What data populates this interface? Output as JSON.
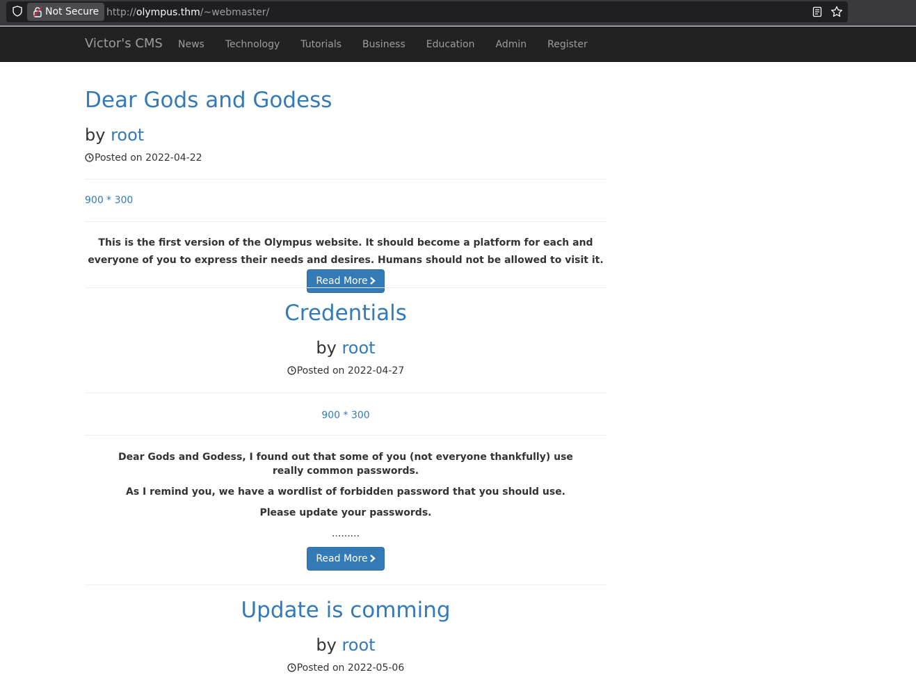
{
  "browser": {
    "security_label": "Not Secure",
    "url_scheme": "http://",
    "url_host": "olympus.thm",
    "url_path": "/~webmaster/"
  },
  "navbar": {
    "brand": "Victor's CMS",
    "links": [
      "News",
      "Technology",
      "Tutorials",
      "Business",
      "Education",
      "Admin",
      "Register"
    ]
  },
  "posts": [
    {
      "title": "Dear Gods and Godess",
      "by": "by",
      "author": "root",
      "posted_prefix": "Posted on",
      "date": "2022-04-22",
      "image_placeholder": "900 * 300",
      "excerpt": "This is the first version of the Olympus website. It should become a platform for each and everyone of you to express their needs and desires. Humans should not be allowed to visit it.",
      "read_more": "Read More"
    },
    {
      "title": "Credentials",
      "by": "by",
      "author": "root",
      "posted_prefix": "Posted on",
      "date": "2022-04-27",
      "image_placeholder": "900 * 300",
      "paragraphs": [
        "Dear Gods and Godess, I found out that some of you (not everyone thankfully) use really common passwords.",
        "As I remind you, we have a wordlist of forbidden password that you should use.",
        "Please update your passwords.",
        "........."
      ],
      "read_more": "Read More"
    },
    {
      "title": "Update is comming",
      "by": "by",
      "author": "root",
      "posted_prefix": "Posted on",
      "date": "2022-05-06"
    }
  ]
}
